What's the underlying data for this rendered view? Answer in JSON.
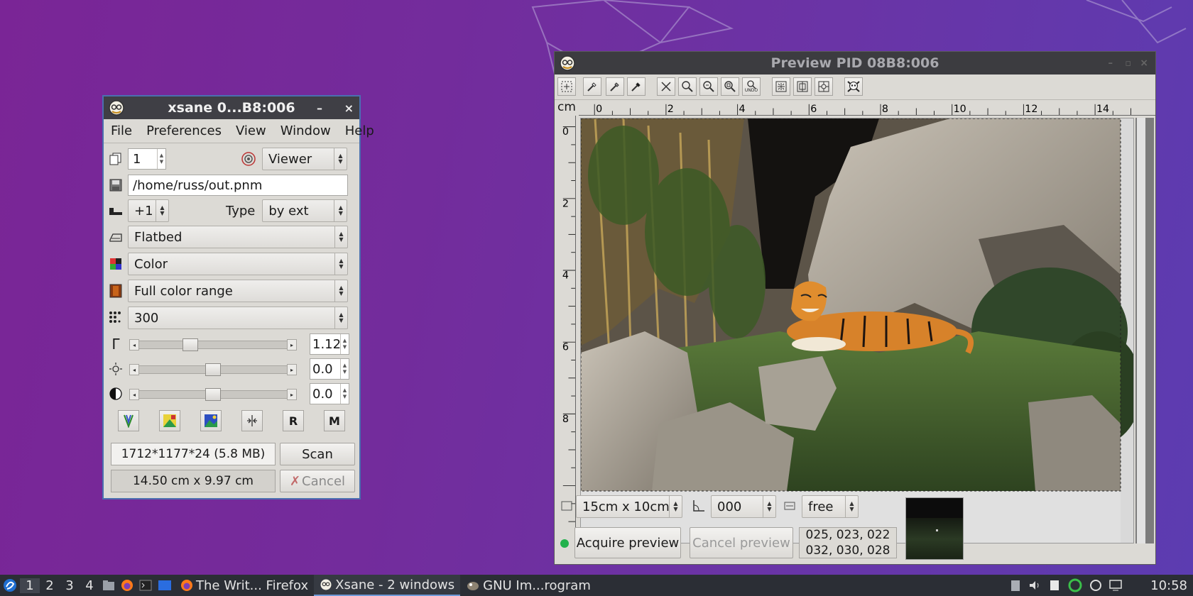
{
  "xsane": {
    "title": "xsane 0...B8:006",
    "minimize": "–",
    "close": "×",
    "menu": [
      "File",
      "Preferences",
      "View",
      "Window",
      "Help"
    ],
    "copies": "1",
    "target": "Viewer",
    "filename": "/home/russ/out.pnm",
    "step": "+1",
    "type_label": "Type",
    "type_value": "by ext",
    "source": "Flatbed",
    "mode": "Color",
    "depth": "Full color range",
    "resolution": "300",
    "gamma": {
      "value": "1.12",
      "slider_level": 0.33
    },
    "brightness": {
      "value": "0.0",
      "slider_level": 0.5
    },
    "contrast": {
      "value": "0.0",
      "slider_level": 0.5
    },
    "image_info": "1712*1177*24 (5.8 MB)",
    "image_size": "14.50 cm x 9.97 cm",
    "scan_button": "Scan",
    "cancel_button": "Cancel"
  },
  "preview": {
    "title": "Preview PID 08B8:006",
    "ruler_unit": "cm",
    "ruler_h_labels": [
      "0",
      "2",
      "4",
      "6",
      "8",
      "10",
      "12",
      "14"
    ],
    "ruler_v_labels": [
      "0",
      "2",
      "4",
      "6",
      "8"
    ],
    "preset_size": "15cm x 10cm",
    "rotation": "000",
    "aspect": "free",
    "acquire_button": "Acquire preview",
    "cancel_button": "Cancel preview",
    "pixel_values_line1": "025, 023, 022",
    "pixel_values_line2": "032, 030, 028"
  },
  "taskbar": {
    "workspaces": [
      "1",
      "2",
      "3",
      "4"
    ],
    "tasks": [
      "The Writ... Firefox",
      "Xsane - 2 windows",
      "GNU Im...rogram"
    ],
    "clock": "10:58"
  },
  "colors": {
    "desktop": "#7a2596",
    "titlebar": "#3f3f45",
    "window_bg": "#dcdad5",
    "taskbar": "#2b2e35",
    "status_led": "#22b14c"
  }
}
